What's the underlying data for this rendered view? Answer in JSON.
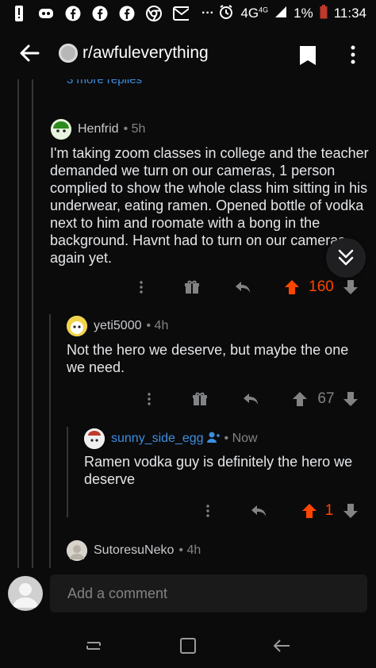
{
  "status_bar": {
    "network": "4G",
    "network_sup": "4G",
    "battery": "1%",
    "time": "11:34",
    "overflow": "···"
  },
  "app_bar": {
    "subreddit": "r/awfuleverything"
  },
  "thread": {
    "more_replies": "3 more replies",
    "comments": [
      {
        "user": "Henfrid",
        "age": "5h",
        "body": "I'm taking zoom classes in college and the teacher demanded we turn on our cameras, 1 person complied to show the whole class him sitting in his underwear, eating ramen. Opened bottle of vodka next to him and roomate with a bong in the background. Havnt had to turn on our cameras again yet.",
        "score": "160"
      },
      {
        "user": "yeti5000",
        "age": "4h",
        "body": "Not the hero we deserve, but maybe the one we need.",
        "score": "67"
      },
      {
        "user": "sunny_side_egg",
        "age": "Now",
        "body": "Ramen vodka guy is definitely the hero we deserve",
        "score": "1"
      },
      {
        "user": "SutoresuNeko",
        "age": "4h"
      }
    ]
  },
  "composer": {
    "placeholder": "Add a comment"
  },
  "colors": {
    "upvote_active": "#ff4500",
    "link": "#3d8ee0",
    "background": "#0b0b0c"
  }
}
